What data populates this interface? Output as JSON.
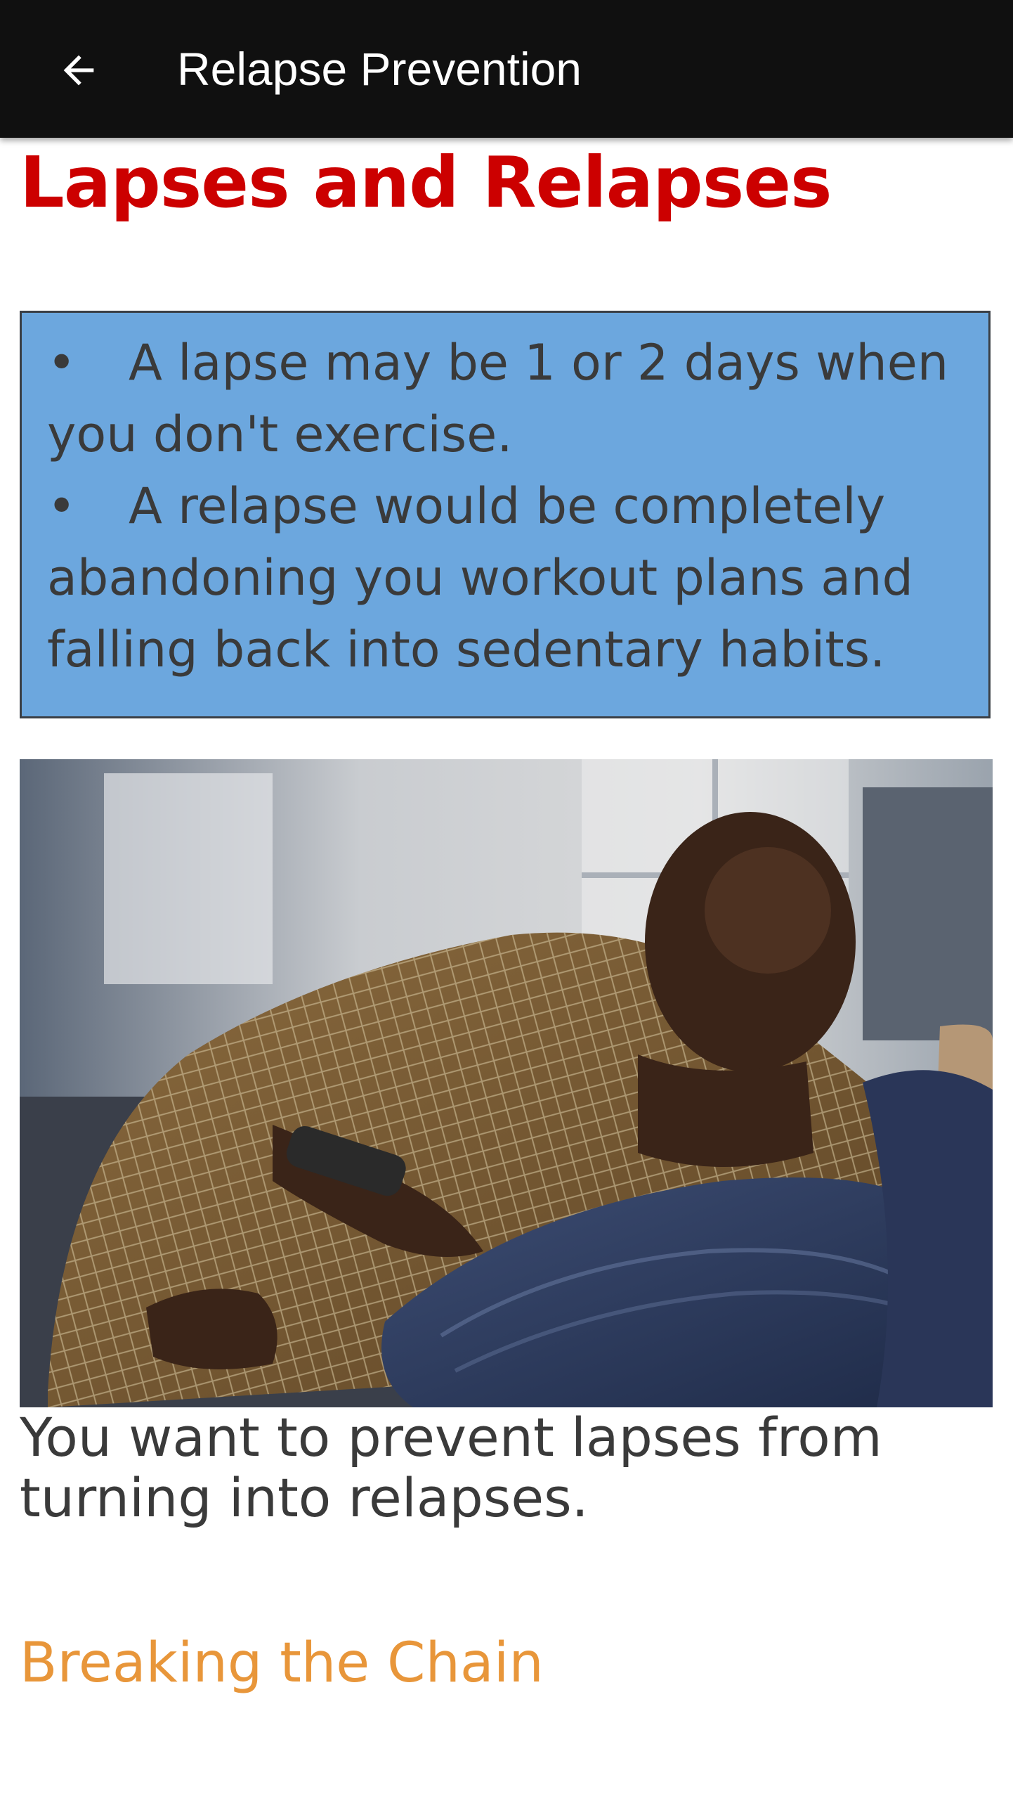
{
  "appbar": {
    "title": "Relapse Prevention",
    "back_icon": "arrow-left-icon"
  },
  "page": {
    "heading": "Lapses and Relapses",
    "info_box": {
      "background": "#6ca7de",
      "bullet_glyph": "•",
      "items": [
        "A lapse may be 1 or 2 days when you don't exercise.",
        "A relapse would be completely abandoning you workout plans and falling back into sedentary habits."
      ]
    },
    "caption": "You want to prevent lapses from turning into relapses.",
    "next_link": "Breaking the Chain"
  },
  "colors": {
    "appbar_bg": "#101010",
    "heading": "#cc0000",
    "link": "#e8963a",
    "body_text": "#3a3a3a"
  }
}
